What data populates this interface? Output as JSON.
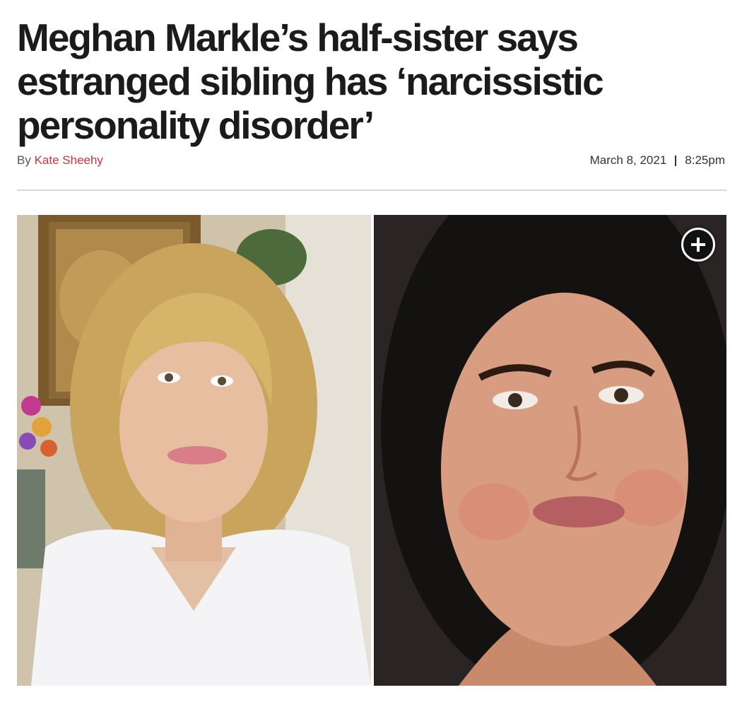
{
  "article": {
    "headline": "Meghan Markle’s half-sister says estranged sibling has ‘narcissistic personality disorder’",
    "byline_prefix": "By",
    "author": "Kate Sheehy",
    "date": "March 8, 2021",
    "time": "8:25pm"
  },
  "media": {
    "expand_icon": "plus-circle-icon"
  },
  "colors": {
    "author_link": "#d0343a",
    "headline": "#1b1b1b",
    "divider": "#d8d8d8"
  }
}
